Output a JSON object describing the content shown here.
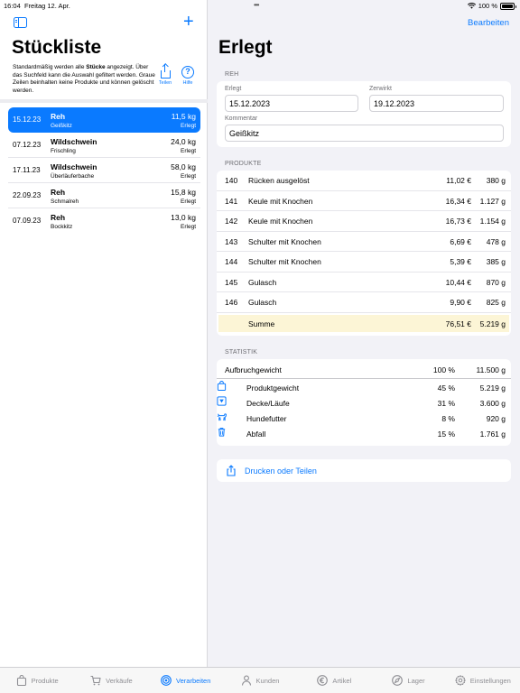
{
  "status": {
    "time": "16:04",
    "date": "Freitag 12. Apr.",
    "battery": "100 %"
  },
  "sidebar": {
    "title": "Stückliste",
    "description_pre": "Standardmäßig werden alle ",
    "description_bold": "Stücke",
    "description_post": " angezeigt. Über das Suchfeld kann die Auswahl gefiltert werden. Graue Zeilen beinhalten keine Produkte und können gelöscht werden.",
    "share_label": "Teilen",
    "help_label": "Hilfe",
    "items": [
      {
        "date": "15.12.23",
        "name": "Reh",
        "sub": "Geißkitz",
        "weight": "11,5 kg",
        "status": "Erlegt",
        "selected": true
      },
      {
        "date": "07.12.23",
        "name": "Wildschwein",
        "sub": "Frischling",
        "weight": "24,0 kg",
        "status": "Erlegt"
      },
      {
        "date": "17.11.23",
        "name": "Wildschwein",
        "sub": "Überläuferbache",
        "weight": "58,0 kg",
        "status": "Erlegt"
      },
      {
        "date": "22.09.23",
        "name": "Reh",
        "sub": "Schmalreh",
        "weight": "15,8 kg",
        "status": "Erlegt"
      },
      {
        "date": "07.09.23",
        "name": "Reh",
        "sub": "Bockkitz",
        "weight": "13,0 kg",
        "status": "Erlegt"
      }
    ]
  },
  "main": {
    "edit_label": "Bearbeiten",
    "title": "Erlegt",
    "section_reh": "REH",
    "erlegt_label": "Erlegt",
    "erlegt_value": "15.12.2023",
    "zerwirkt_label": "Zerwirkt",
    "zerwirkt_value": "19.12.2023",
    "kommentar_label": "Kommentar",
    "kommentar_value": "Geißkitz",
    "section_produkte": "PRODUKTE",
    "products": [
      {
        "nr": "140",
        "name": "Rücken ausgelöst",
        "price": "11,02 €",
        "weight": "380 g"
      },
      {
        "nr": "141",
        "name": "Keule mit Knochen",
        "price": "16,34 €",
        "weight": "1.127 g"
      },
      {
        "nr": "142",
        "name": "Keule mit Knochen",
        "price": "16,73 €",
        "weight": "1.154 g"
      },
      {
        "nr": "143",
        "name": "Schulter mit Knochen",
        "price": "6,69 €",
        "weight": "478 g"
      },
      {
        "nr": "144",
        "name": "Schulter mit Knochen",
        "price": "5,39 €",
        "weight": "385 g"
      },
      {
        "nr": "145",
        "name": "Gulasch",
        "price": "10,44 €",
        "weight": "870 g"
      },
      {
        "nr": "146",
        "name": "Gulasch",
        "price": "9,90 €",
        "weight": "825 g"
      }
    ],
    "sum": {
      "label": "Summe",
      "price": "76,51 €",
      "weight": "5.219 g"
    },
    "section_statistik": "STATISTIK",
    "stat_total": {
      "label": "Aufbruchgewicht",
      "percent": "100 %",
      "weight": "11.500 g"
    },
    "stats": [
      {
        "icon": "bag-icon",
        "label": "Produktgewicht",
        "percent": "45 %",
        "weight": "5.219 g"
      },
      {
        "icon": "hide-icon",
        "label": "Decke/Läufe",
        "percent": "31 %",
        "weight": "3.600 g"
      },
      {
        "icon": "dog-icon",
        "label": "Hundefutter",
        "percent": "8 %",
        "weight": "920 g"
      },
      {
        "icon": "trash-icon",
        "label": "Abfall",
        "percent": "15 %",
        "weight": "1.761 g"
      }
    ],
    "print_label": "Drucken oder Teilen"
  },
  "tabs": [
    {
      "label": "Produkte",
      "icon": "bag-icon"
    },
    {
      "label": "Verkäufe",
      "icon": "cart-icon"
    },
    {
      "label": "Verarbeiten",
      "icon": "target-icon",
      "active": true
    },
    {
      "label": "Kunden",
      "icon": "person-icon"
    },
    {
      "label": "Artikel",
      "icon": "euro-icon"
    },
    {
      "label": "Lager",
      "icon": "location-icon"
    },
    {
      "label": "Einstellungen",
      "icon": "gear-icon"
    }
  ],
  "colors": {
    "accent": "#0a7aff",
    "sum_highlight": "#fcf5d6",
    "background": "#f2f2f7"
  }
}
